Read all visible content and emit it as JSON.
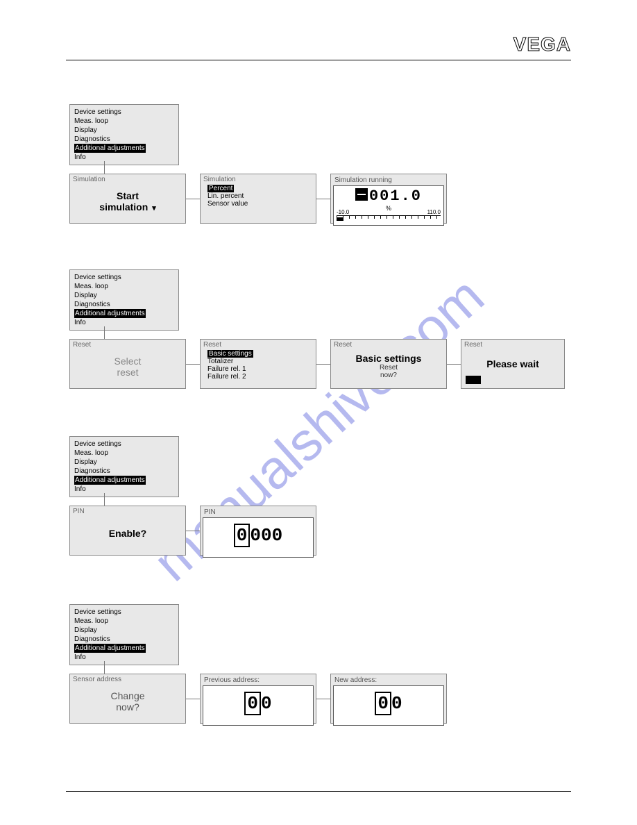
{
  "logo": "VEGA",
  "watermark": "manualshive.com",
  "menu": {
    "items": [
      "Device settings",
      "Meas. loop",
      "Display",
      "Diagnostics",
      "Additional adjustments",
      "Info"
    ],
    "selected_index": 4
  },
  "sections": {
    "simulation": {
      "screen1": {
        "title": "Simulation",
        "line1": "Start",
        "line2": "simulation"
      },
      "screen2": {
        "title": "Simulation",
        "options": [
          "Percent",
          "Lin. percent",
          "Sensor value"
        ],
        "selected_index": 0
      },
      "screen3": {
        "title": "Simulation running",
        "value": "001.0",
        "sign": "negative",
        "unit": "%",
        "scale_min": "-10.0",
        "scale_max": "110.0"
      }
    },
    "reset": {
      "screen1": {
        "title": "Reset",
        "line1": "Select",
        "line2": "reset"
      },
      "screen2": {
        "title": "Reset",
        "options": [
          "Basic settings",
          "Totalizer",
          "Failure rel. 1",
          "Failure rel. 2"
        ],
        "selected_index": 0
      },
      "screen3": {
        "title": "Reset",
        "heading": "Basic settings",
        "sub1": "Reset",
        "sub2": "now?"
      },
      "screen4": {
        "title": "Reset",
        "text": "Please wait"
      }
    },
    "pin": {
      "screen1": {
        "title": "PIN",
        "text": "Enable?"
      },
      "screen2": {
        "title": "PIN",
        "digit_highlight": "0",
        "digits_rest": "000"
      }
    },
    "sensor_address": {
      "screen1": {
        "title": "Sensor address",
        "line1": "Change",
        "line2": "now?"
      },
      "screen2": {
        "title": "Previous address:",
        "digit_highlight": "0",
        "digits_rest": "0"
      },
      "screen3": {
        "title": "New address:",
        "digit_highlight": "0",
        "digits_rest": "0"
      }
    }
  }
}
